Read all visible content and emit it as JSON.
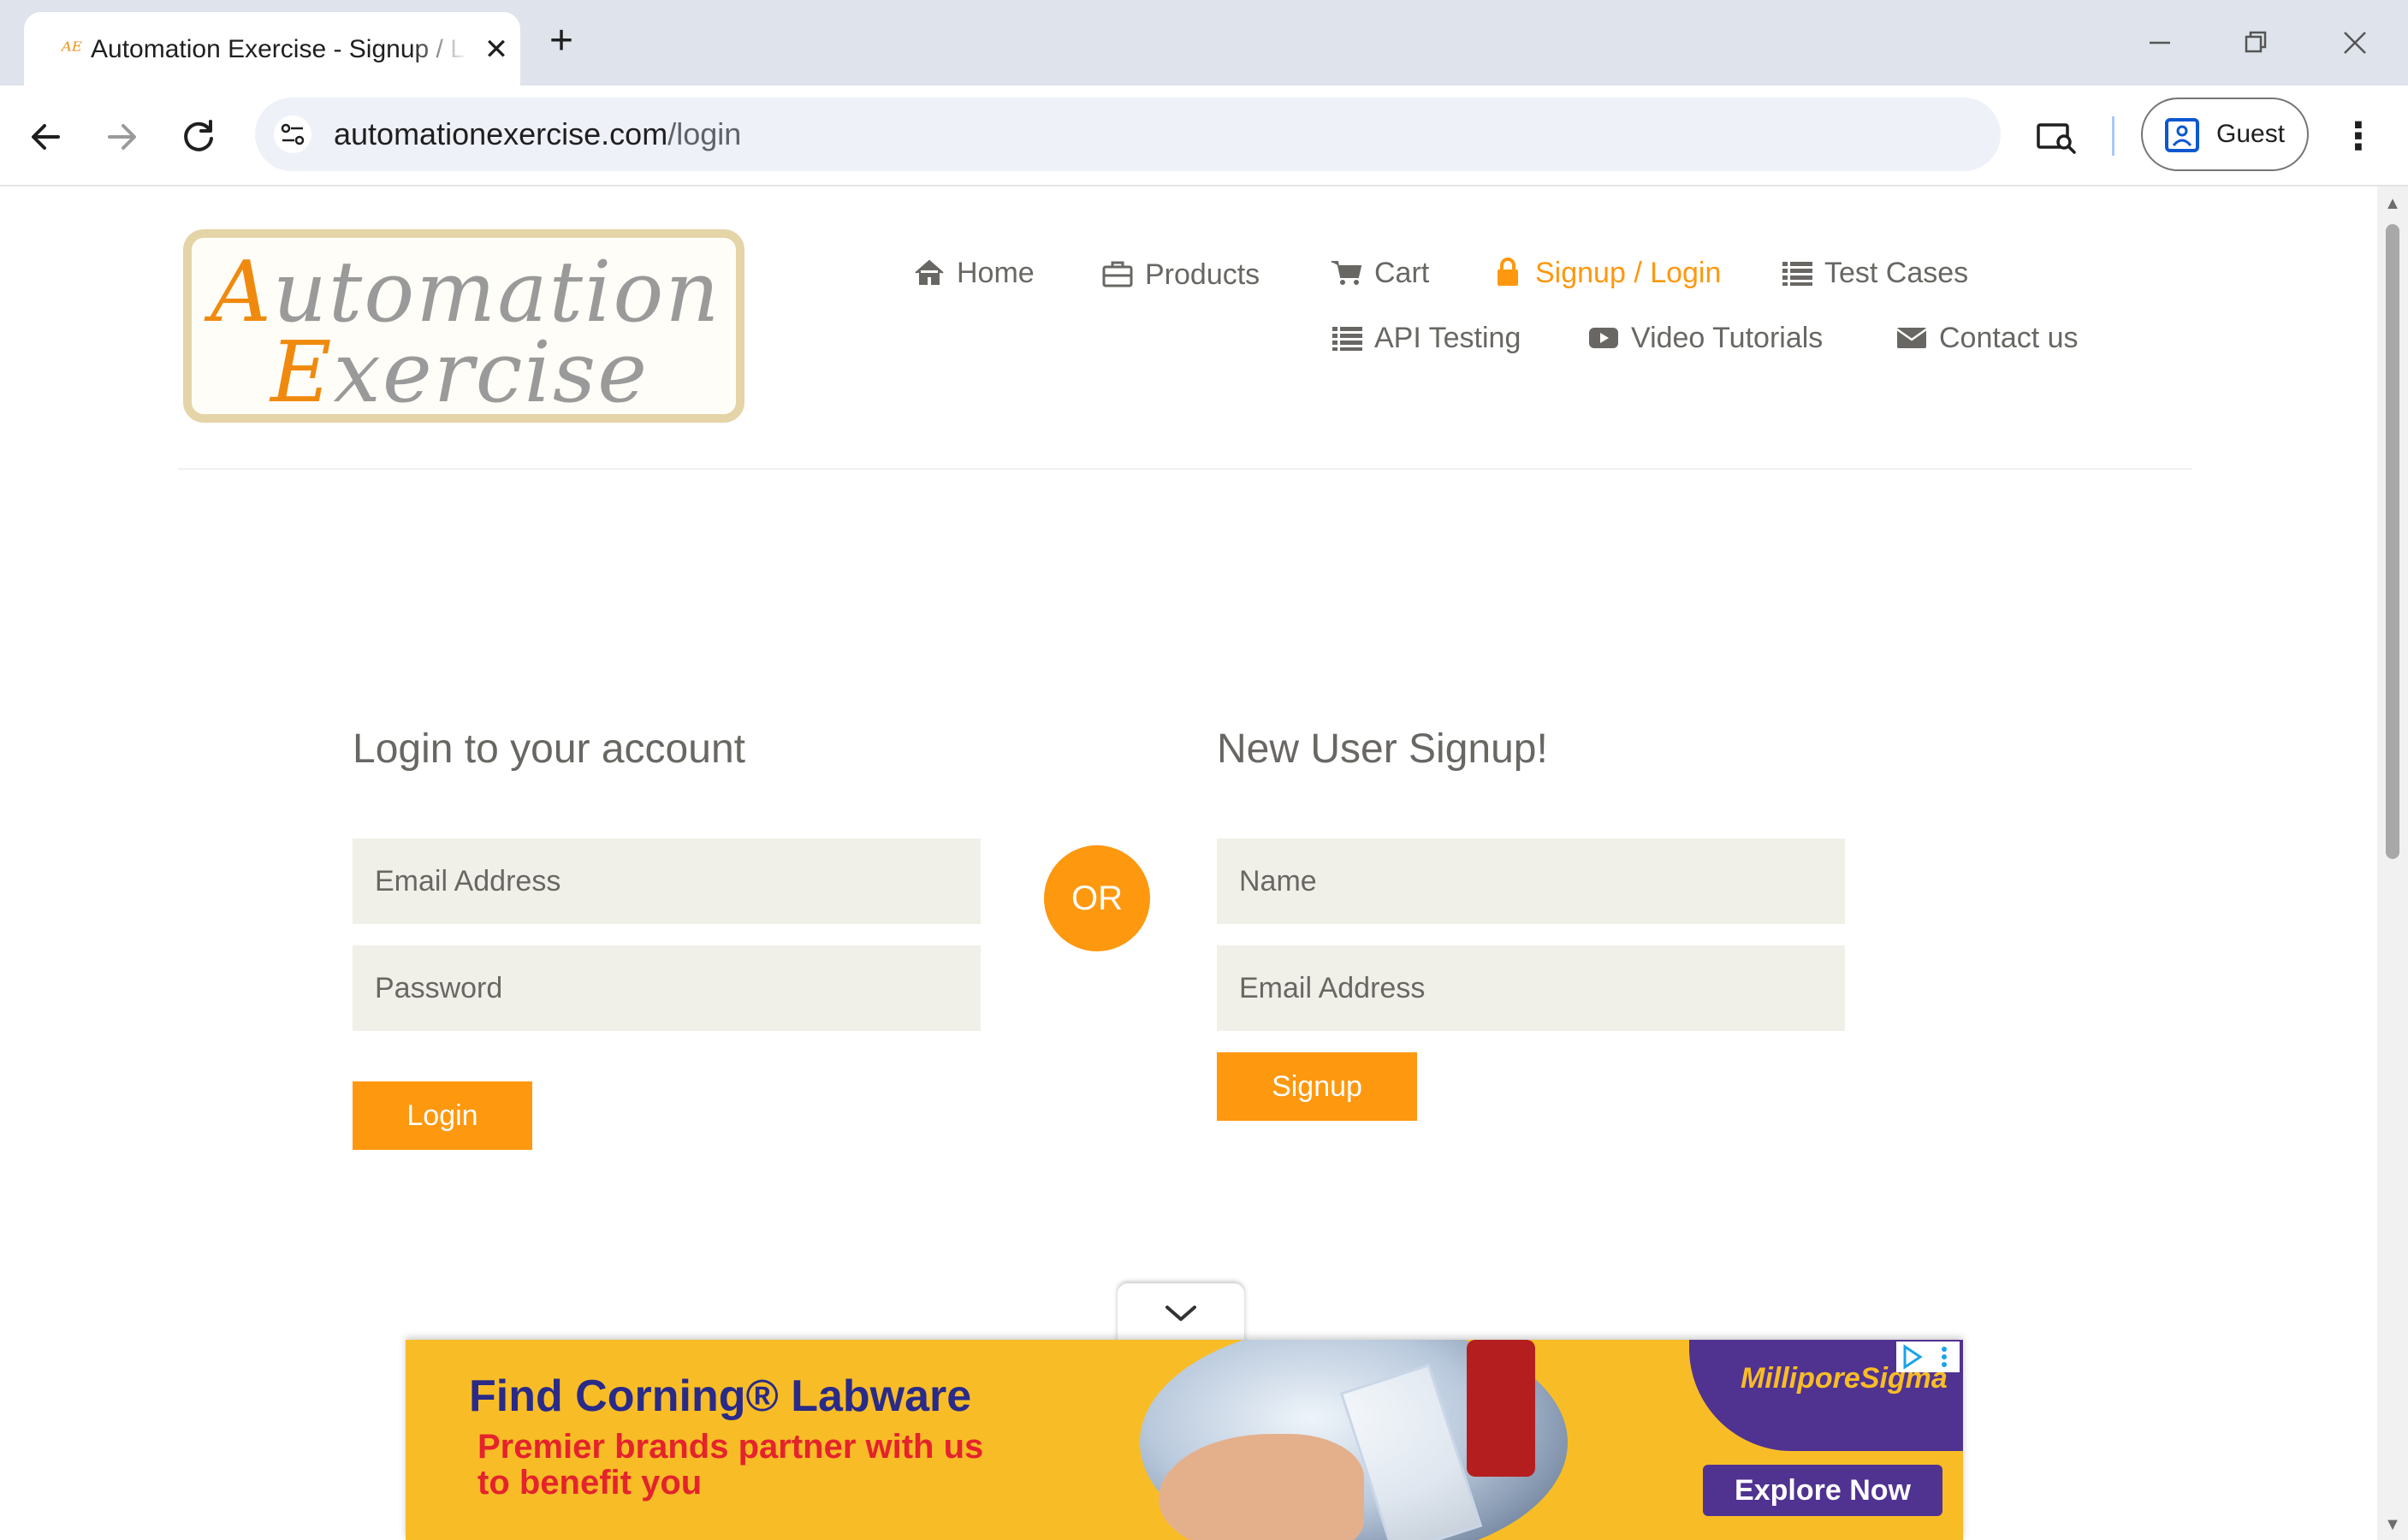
{
  "browser": {
    "tab_title": "Automation Exercise - Signup / Login",
    "tab_favicon": "AE",
    "url_domain": "automationexercise.com",
    "url_path": "/login",
    "profile_label": "Guest"
  },
  "site": {
    "logo_line1_cap": "A",
    "logo_line1_rest": "utomation",
    "logo_line2_cap": "E",
    "logo_line2_rest": "xercise",
    "nav": [
      {
        "label": "Home",
        "icon": "home-icon"
      },
      {
        "label": "Products",
        "icon": "briefcase-icon"
      },
      {
        "label": "Cart",
        "icon": "cart-icon"
      },
      {
        "label": "Signup / Login",
        "icon": "lock-icon",
        "active": true
      },
      {
        "label": "Test Cases",
        "icon": "list-icon"
      },
      {
        "label": "API Testing",
        "icon": "list-icon"
      },
      {
        "label": "Video Tutorials",
        "icon": "youtube-icon"
      },
      {
        "label": "Contact us",
        "icon": "envelope-icon"
      }
    ],
    "accent_color": "#FE980F"
  },
  "login": {
    "title": "Login to your account",
    "email_placeholder": "Email Address",
    "password_placeholder": "Password",
    "button": "Login"
  },
  "divider": "OR",
  "signup": {
    "title": "New User Signup!",
    "name_placeholder": "Name",
    "email_placeholder": "Email Address",
    "button": "Signup"
  },
  "ad": {
    "headline": "Find Corning® Labware",
    "subline": "Premier brands partner with us to benefit you",
    "brand": "MilliporeSigma",
    "cta": "Explore Now"
  }
}
